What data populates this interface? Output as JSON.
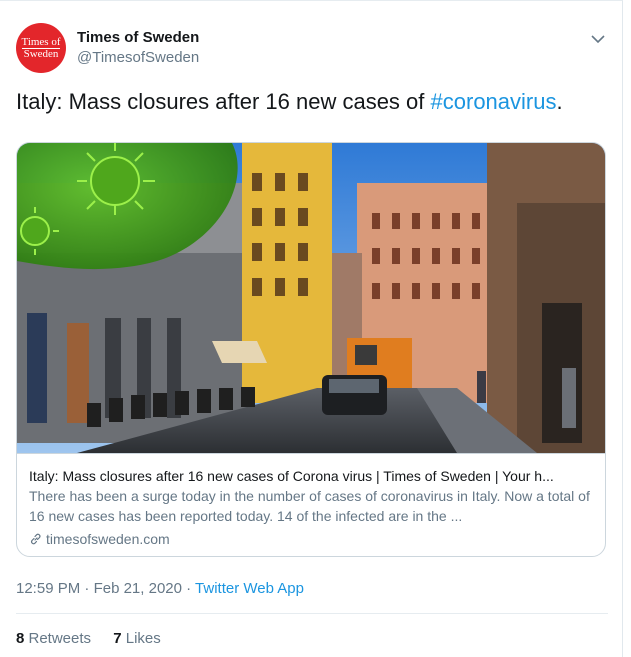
{
  "account": {
    "avatar_line1": "Times of",
    "avatar_line2": "Sweden",
    "display_name": "Times of Sweden",
    "handle": "@TimesofSweden",
    "avatar_color": "#e3262b"
  },
  "tweet": {
    "text_before": "Italy: Mass closures after 16 new cases of ",
    "hashtag": "#coronavirus",
    "text_after": "."
  },
  "card": {
    "title": "Italy: Mass closures after 16 new cases of Corona virus | Times of Sweden | Your h...",
    "description": "There has been a surge today in the number of cases of coronavirus in Italy. Now a total of 16 new cases has been reported today. 14 of the infected are in the ...",
    "domain": "timesofsweden.com",
    "image_subject": "Street scene in Milan with virus graphic overlay"
  },
  "meta": {
    "time": "12:59 PM",
    "separator": " · ",
    "date": "Feb 21, 2020",
    "app": "Twitter Web App"
  },
  "stats": {
    "retweets_count": "8",
    "retweets_label": " Retweets",
    "likes_count": "7",
    "likes_label": " Likes"
  },
  "colors": {
    "link": "#1b95e0",
    "secondary_text": "#657786",
    "primary_text": "#14171a",
    "border": "#ccd6dd"
  },
  "icons": [
    "chevron-down-icon",
    "link-icon"
  ]
}
